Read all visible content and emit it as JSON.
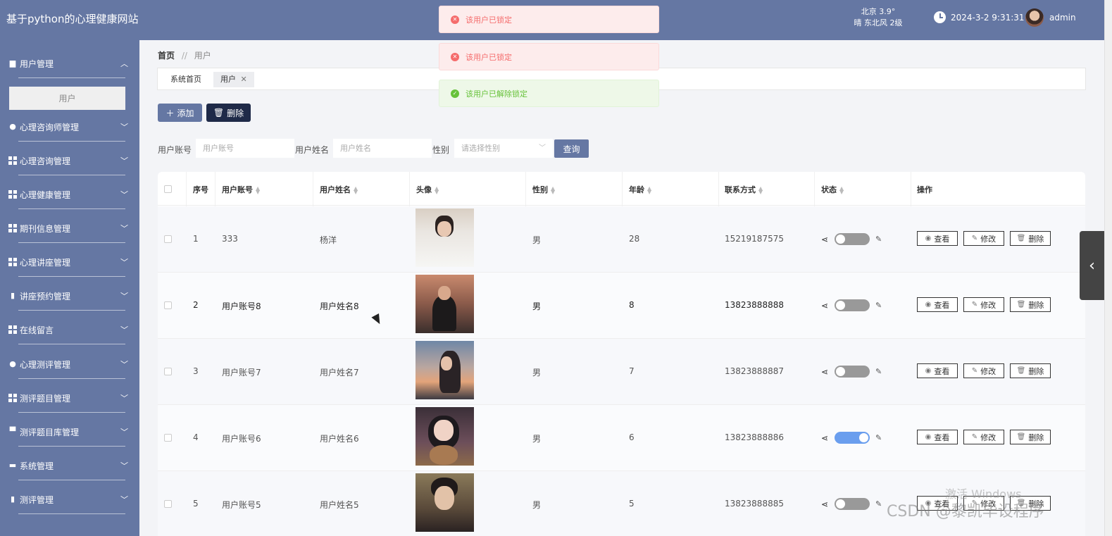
{
  "app": {
    "title": "基于python的心理健康网站"
  },
  "header": {
    "weather_line1": "北京  3.9°",
    "weather_line2": "晴  东北风  2级",
    "datetime": "2024-3-2 9:31:31",
    "username": "admin"
  },
  "sidebar": {
    "items": [
      {
        "label": "用户管理",
        "icon": "briefcase-icon",
        "expanded": true
      },
      {
        "label": "心理咨询师管理",
        "icon": "lightbulb-icon"
      },
      {
        "label": "心理咨询管理",
        "icon": "grid-icon"
      },
      {
        "label": "心理健康管理",
        "icon": "grid-icon"
      },
      {
        "label": "期刊信息管理",
        "icon": "grid-icon"
      },
      {
        "label": "心理讲座管理",
        "icon": "grid-icon"
      },
      {
        "label": "讲座预约管理",
        "icon": "clipboard-icon"
      },
      {
        "label": "在线留言",
        "icon": "grid-icon"
      },
      {
        "label": "心理测评管理",
        "icon": "user-icon"
      },
      {
        "label": "测评题目管理",
        "icon": "grid-icon"
      },
      {
        "label": "测评题目库管理",
        "icon": "signpost-icon"
      },
      {
        "label": "系统管理",
        "icon": "chat-icon"
      },
      {
        "label": "测评管理",
        "icon": "clipboard-icon"
      }
    ],
    "submenu_label": "用户"
  },
  "breadcrumb": {
    "home": "首页",
    "separator": "//",
    "current": "用户"
  },
  "tabs": {
    "home": "系统首页",
    "active": "用户"
  },
  "toolbar": {
    "add_label": "添加",
    "delete_label": "删除"
  },
  "search": {
    "account_label": "用户账号",
    "account_placeholder": "用户账号",
    "name_label": "用户姓名",
    "name_placeholder": "用户姓名",
    "gender_label": "性别",
    "gender_placeholder": "请选择性别",
    "query_label": "查询"
  },
  "table": {
    "headers": [
      "序号",
      "用户账号",
      "用户姓名",
      "头像",
      "性别",
      "年龄",
      "联系方式",
      "状态",
      "操作"
    ],
    "rows": [
      {
        "index": "1",
        "account": "333",
        "name": "杨洋",
        "gender": "男",
        "age": "28",
        "phone": "15219187575",
        "status_on": false
      },
      {
        "index": "2",
        "account": "用户账号8",
        "name": "用户姓名8",
        "gender": "男",
        "age": "8",
        "phone": "13823888888",
        "status_on": false
      },
      {
        "index": "3",
        "account": "用户账号7",
        "name": "用户姓名7",
        "gender": "男",
        "age": "7",
        "phone": "13823888887",
        "status_on": false
      },
      {
        "index": "4",
        "account": "用户账号6",
        "name": "用户姓名6",
        "gender": "男",
        "age": "6",
        "phone": "13823888886",
        "status_on": true
      },
      {
        "index": "5",
        "account": "用户账号5",
        "name": "用户姓名5",
        "gender": "男",
        "age": "5",
        "phone": "13823888885",
        "status_on": false
      }
    ],
    "actions": {
      "view": "查看",
      "edit": "修改",
      "delete": "删除"
    }
  },
  "toasts": [
    {
      "type": "error",
      "text": "该用户已锁定"
    },
    {
      "type": "error",
      "text": "该用户已锁定"
    },
    {
      "type": "success",
      "text": "该用户已解除锁定"
    }
  ],
  "watermark": {
    "line1": "激活 Windows",
    "line2": "CSDN @黎凯毕设程序"
  },
  "colors": {
    "primary": "#6577a3",
    "dark_button": "#1f2a48",
    "switch_on": "#6a9eee",
    "error": "#f56c6c",
    "success": "#67c23a"
  }
}
